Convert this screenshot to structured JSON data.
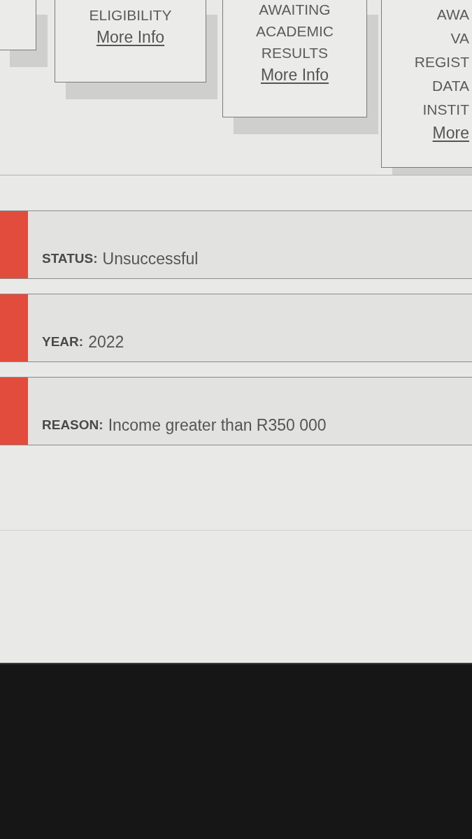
{
  "cards": [
    {
      "title_lines": [
        "ELIGIBILITY"
      ],
      "link": "More Info"
    },
    {
      "title_lines": [
        "AWAITING",
        "ACADEMIC",
        "RESULTS"
      ],
      "link": "More Info"
    },
    {
      "title_lines": [
        "AWA",
        "VA",
        "REGIST",
        "DATA",
        "INSTIT"
      ],
      "link": "More"
    }
  ],
  "details": [
    {
      "label": "STATUS:",
      "value": "Unsuccessful"
    },
    {
      "label": "YEAR:",
      "value": "2022"
    },
    {
      "label": "REASON:",
      "value": "Income greater than R350 000"
    }
  ]
}
